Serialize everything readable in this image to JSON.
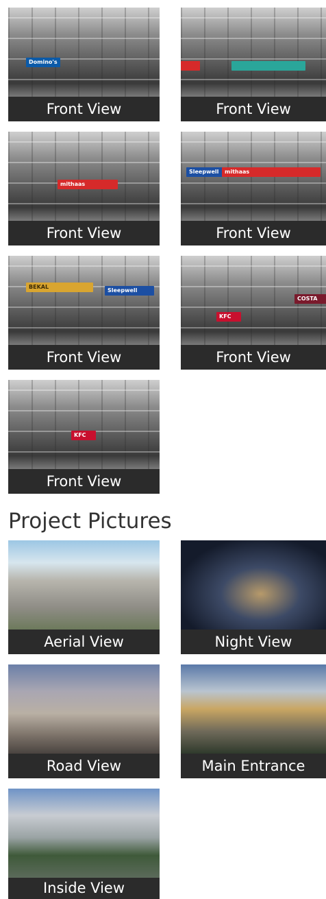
{
  "front_views": [
    {
      "caption": "Front View",
      "signs": [
        "Domino's"
      ]
    },
    {
      "caption": "Front View",
      "signs": [
        ""
      ]
    },
    {
      "caption": "Front View",
      "signs": [
        "mithaas"
      ]
    },
    {
      "caption": "Front View",
      "signs": [
        "Sleepwell",
        "mithaas"
      ]
    },
    {
      "caption": "Front View",
      "signs": [
        "BEKAL",
        "Sleepwell"
      ]
    },
    {
      "caption": "Front View",
      "signs": [
        "KFC",
        "COSTA"
      ]
    },
    {
      "caption": "Front View",
      "signs": [
        "KFC"
      ]
    }
  ],
  "project_pictures": {
    "heading": "Project Pictures",
    "items": [
      {
        "caption": "Aerial View"
      },
      {
        "caption": "Night View"
      },
      {
        "caption": "Road View"
      },
      {
        "caption": "Main Entrance"
      },
      {
        "caption": "Inside View"
      }
    ]
  },
  "colors": {
    "caption_bg": "#2b2b2b",
    "caption_text": "#ffffff",
    "heading_text": "#333333",
    "dominos_blue": "#0b5aa8",
    "mithaas_red": "#d62a2a",
    "sleepwell_blue": "#1c4fa3",
    "bekal_gold": "#d9a530",
    "kfc_red": "#c8102e",
    "costa_maroon": "#7a1a2c"
  }
}
